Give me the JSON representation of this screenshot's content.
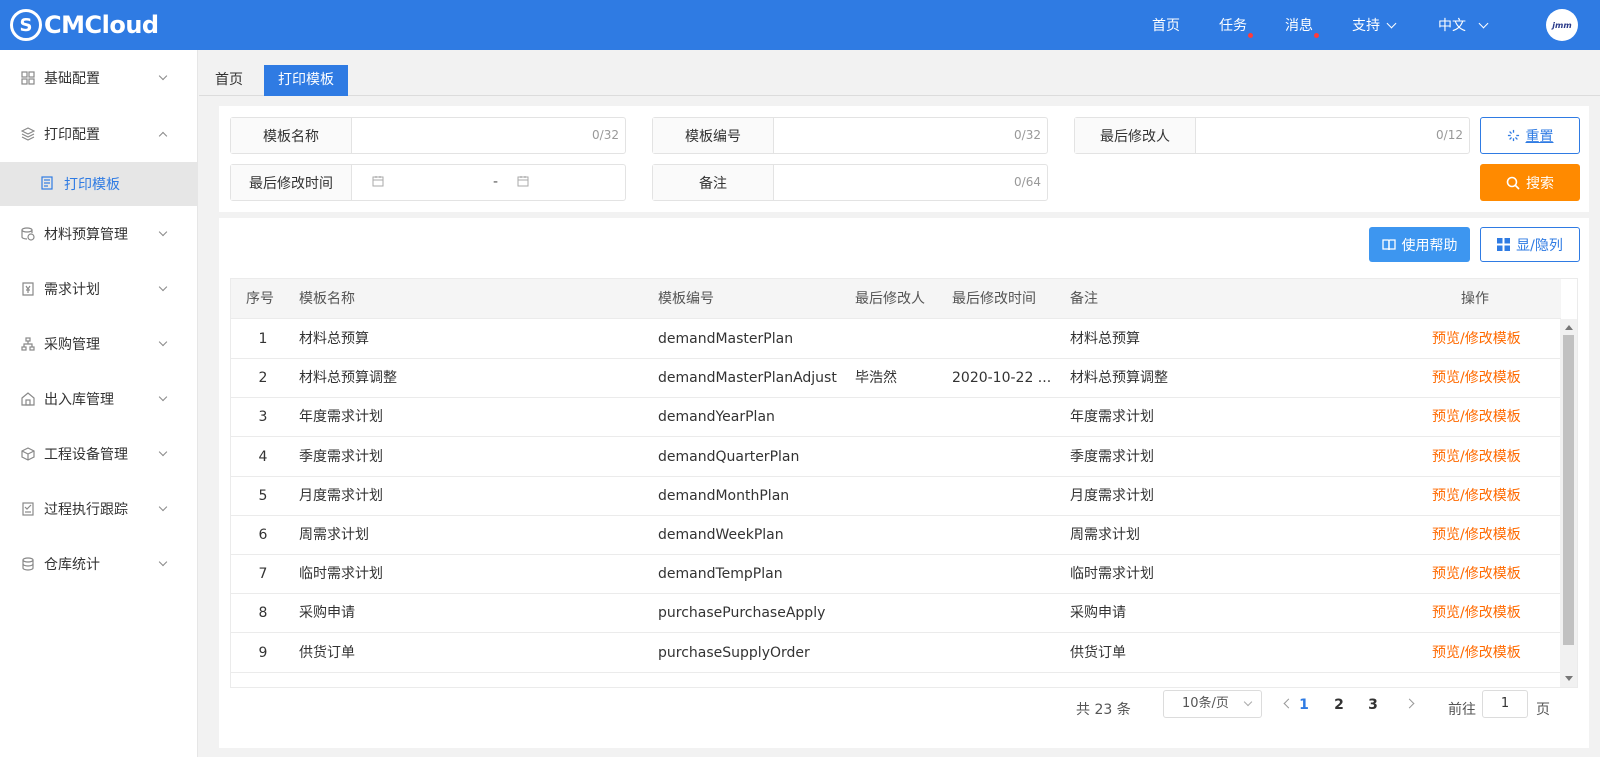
{
  "header": {
    "brand": "CMCloud",
    "logo_letter": "S",
    "nav": [
      "首页",
      "任务",
      "消息",
      "支持",
      "中文"
    ],
    "avatar_text": "jmm"
  },
  "sidebar": {
    "items": [
      {
        "label": "基础配置",
        "icon": "grid-icon"
      },
      {
        "label": "打印配置",
        "icon": "layers-icon"
      },
      {
        "label": "材料预算管理",
        "icon": "coins-icon"
      },
      {
        "label": "需求计划",
        "icon": "yen-doc-icon"
      },
      {
        "label": "采购管理",
        "icon": "org-chart-icon"
      },
      {
        "label": "出入库管理",
        "icon": "warehouse-icon"
      },
      {
        "label": "工程设备管理",
        "icon": "cube-icon"
      },
      {
        "label": "过程执行跟踪",
        "icon": "checklist-icon"
      },
      {
        "label": "仓库统计",
        "icon": "database-icon"
      }
    ],
    "sub_item": "打印模板"
  },
  "tabs": [
    "首页",
    "打印模板"
  ],
  "filters": {
    "template_name": {
      "label": "模板名称",
      "count": "0/32"
    },
    "template_code": {
      "label": "模板编号",
      "count": "0/32"
    },
    "last_modifier": {
      "label": "最后修改人",
      "count": "0/12"
    },
    "last_modified_time": {
      "label": "最后修改时间",
      "separator": "-"
    },
    "remark": {
      "label": "备注",
      "count": "0/64"
    }
  },
  "buttons": {
    "reset": "重置",
    "search": "搜索",
    "help": "使用帮助",
    "columns": "显/隐列"
  },
  "table": {
    "headers": [
      "序号",
      "模板名称",
      "模板编号",
      "最后修改人",
      "最后修改时间",
      "备注",
      "操作"
    ],
    "rows": [
      {
        "no": "1",
        "name": "材料总预算",
        "code": "demandMasterPlan",
        "modifier": "",
        "time": "",
        "remark": "材料总预算",
        "action": "预览/修改模板"
      },
      {
        "no": "2",
        "name": "材料总预算调整",
        "code": "demandMasterPlanAdjust",
        "modifier": "毕浩然",
        "time": "2020-10-22 ...",
        "remark": "材料总预算调整",
        "action": "预览/修改模板"
      },
      {
        "no": "3",
        "name": "年度需求计划",
        "code": "demandYearPlan",
        "modifier": "",
        "time": "",
        "remark": "年度需求计划",
        "action": "预览/修改模板"
      },
      {
        "no": "4",
        "name": "季度需求计划",
        "code": "demandQuarterPlan",
        "modifier": "",
        "time": "",
        "remark": "季度需求计划",
        "action": "预览/修改模板"
      },
      {
        "no": "5",
        "name": "月度需求计划",
        "code": "demandMonthPlan",
        "modifier": "",
        "time": "",
        "remark": "月度需求计划",
        "action": "预览/修改模板"
      },
      {
        "no": "6",
        "name": "周需求计划",
        "code": "demandWeekPlan",
        "modifier": "",
        "time": "",
        "remark": "周需求计划",
        "action": "预览/修改模板"
      },
      {
        "no": "7",
        "name": "临时需求计划",
        "code": "demandTempPlan",
        "modifier": "",
        "time": "",
        "remark": "临时需求计划",
        "action": "预览/修改模板"
      },
      {
        "no": "8",
        "name": "采购申请",
        "code": "purchasePurchaseApply",
        "modifier": "",
        "time": "",
        "remark": "采购申请",
        "action": "预览/修改模板"
      },
      {
        "no": "9",
        "name": "供货订单",
        "code": "purchaseSupplyOrder",
        "modifier": "",
        "time": "",
        "remark": "供货订单",
        "action": "预览/修改模板"
      }
    ]
  },
  "pagination": {
    "total": "共 23 条",
    "page_size": "10条/页",
    "pages": [
      "1",
      "2",
      "3"
    ],
    "current": "1",
    "goto_prefix": "前往",
    "goto_value": "1",
    "goto_suffix": "页"
  },
  "colors": {
    "primary": "#2f7be3",
    "orange": "#ff8a00",
    "action": "#ff6a00"
  }
}
